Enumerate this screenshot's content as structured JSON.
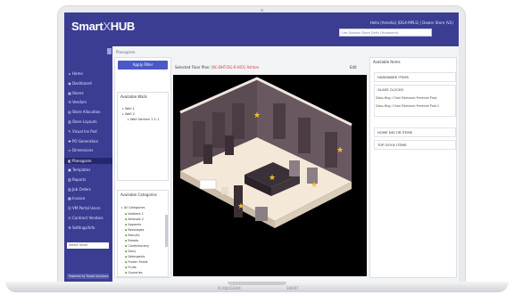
{
  "app": {
    "logo_left": "Smart",
    "logo_x": "X",
    "logo_right": "HUB",
    "user_line": "Hello [Ameilia] (DG4-MPLS) | Dealer Store (V2)",
    "top_input_value": "Lee Dadson Store Delhi [Hardware]"
  },
  "sidebar": {
    "items": [
      {
        "label": "Home",
        "icon": "home-icon"
      },
      {
        "label": "Dashboard",
        "icon": "dashboard-icon"
      },
      {
        "label": "Stores",
        "icon": "stores-icon"
      },
      {
        "label": "Vendors",
        "icon": "vendors-icon"
      },
      {
        "label": "Store Allocation",
        "icon": "allocation-icon"
      },
      {
        "label": "Store Layouts",
        "icon": "layout-icon"
      },
      {
        "label": "Visual Ins Pad",
        "icon": "visual-icon"
      },
      {
        "label": "PO Generation",
        "icon": "po-icon"
      },
      {
        "label": "Dimensions",
        "icon": "dimensions-icon"
      },
      {
        "label": "Planogram",
        "icon": "planogram-icon"
      },
      {
        "label": "Templates",
        "icon": "templates-icon"
      },
      {
        "label": "Reports",
        "icon": "reports-icon"
      },
      {
        "label": "Job Orders",
        "icon": "job-orders-icon"
      },
      {
        "label": "Invoice",
        "icon": "invoice-icon"
      },
      {
        "label": "VM Portal Users",
        "icon": "users-icon"
      },
      {
        "label": "Contract Vendors",
        "icon": "contract-icon"
      },
      {
        "label": "Settings/Info",
        "icon": "settings-icon"
      }
    ],
    "active_index": 9,
    "select_value": "Select Store",
    "footer": "Powered by Tarabi Solutions"
  },
  "main": {
    "breadcrumb": "Planogram",
    "apply_button": "Apply Filter",
    "walls_title": "Available Walls",
    "wall_tree": [
      "Wall 1",
      "Wall 2",
      "Wall Section 1.1.1"
    ],
    "categories_title": "Available Categories",
    "categories_root": "All Categories",
    "categories": [
      "Ambient 1",
      "Aerosols 2",
      "Apparels",
      "Beverages",
      "Biscuits",
      "Breads",
      "Confectionery",
      "Dairy",
      "Detergents",
      "Frozen Foods",
      "Fruits",
      "Groceries"
    ],
    "plan_label_prefix": "Selected Floor Plan: ",
    "plan_label_value": "[KC-BHT-DG-R-001] Ashton",
    "plan_link": "Edit",
    "right_title": "Available Items",
    "right_items": [
      "HARDWARE ITEMS",
      "GLASS CLOCKS"
    ],
    "right_subitems": [
      "Glass Mug / Chair Electronic Premium Prod.",
      "Glass Mug / Chair Electronic Premium Prod 2"
    ],
    "right_items_more": [
      "HOME DECOR ITEMS",
      "TOP DOCK ITEMS"
    ]
  },
  "laptop": {
    "base_left": "PLANOGRAM",
    "base_right": "SMART"
  },
  "colors": {
    "sidebar": "#3b3d93",
    "sidebar_active": "#25276e",
    "accent_button": "#4c58c8",
    "highlight_red": "#d9323b",
    "room_wall": "#5b4b52",
    "room_floor": "#f4e9d8"
  }
}
